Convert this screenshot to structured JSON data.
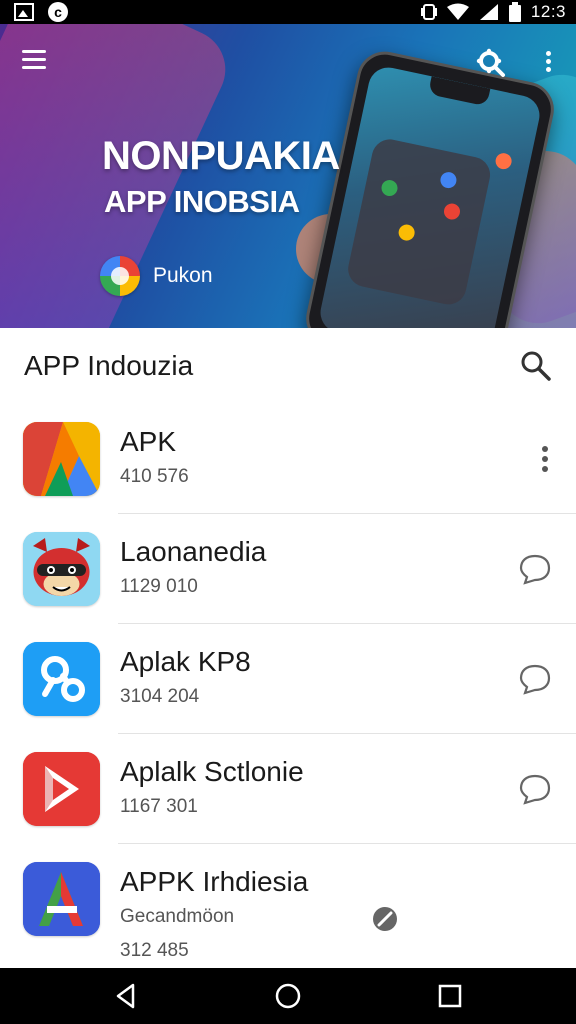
{
  "status_bar": {
    "time": "12:3",
    "left_icons": [
      "gallery-icon",
      "c-app-icon"
    ],
    "right_icons": [
      "vibrate-icon",
      "wifi-icon",
      "signal-icon",
      "battery-icon"
    ]
  },
  "hero": {
    "title": "NONPUAKIA",
    "subtitle": "APP INOBSIA",
    "brand_name": "Pukon",
    "gradient_colors": [
      "#4a2b8f",
      "#1f4fa3",
      "#1a73b8",
      "#35a6c0"
    ],
    "icons": [
      "menu-icon",
      "settings-search-icon",
      "more-vert-icon"
    ]
  },
  "section": {
    "title": "APP Indouzia",
    "search_icon": "search-icon"
  },
  "apps": [
    {
      "name": "APK",
      "meta": "410 576",
      "action_icon": "more-vert-icon",
      "icon_colors": [
        "#f4b400",
        "#db4437",
        "#0f9d58",
        "#4285f4"
      ]
    },
    {
      "name": "Laonanedia",
      "meta": "1129 010",
      "action_icon": "chat-bubble-icon",
      "icon_colors": [
        "#7fd4f0",
        "#d32f2f"
      ]
    },
    {
      "name": "Aplak KP8",
      "meta": "3104 204",
      "action_icon": "chat-bubble-icon",
      "icon_colors": [
        "#1e9ef5"
      ]
    },
    {
      "name": "Aplalk Sctlonie",
      "meta": "1167 301",
      "action_icon": "chat-bubble-icon",
      "icon_colors": [
        "#e53935"
      ]
    },
    {
      "name": "APPK Irhdiesia",
      "meta": "Gecandmöon",
      "meta2": "312 485",
      "action_icon": "link-icon",
      "icon_colors": [
        "#3b5bd9",
        "#43a047",
        "#e53935"
      ]
    }
  ],
  "nav_bar": {
    "buttons": [
      "back-icon",
      "home-icon",
      "recents-icon"
    ]
  }
}
